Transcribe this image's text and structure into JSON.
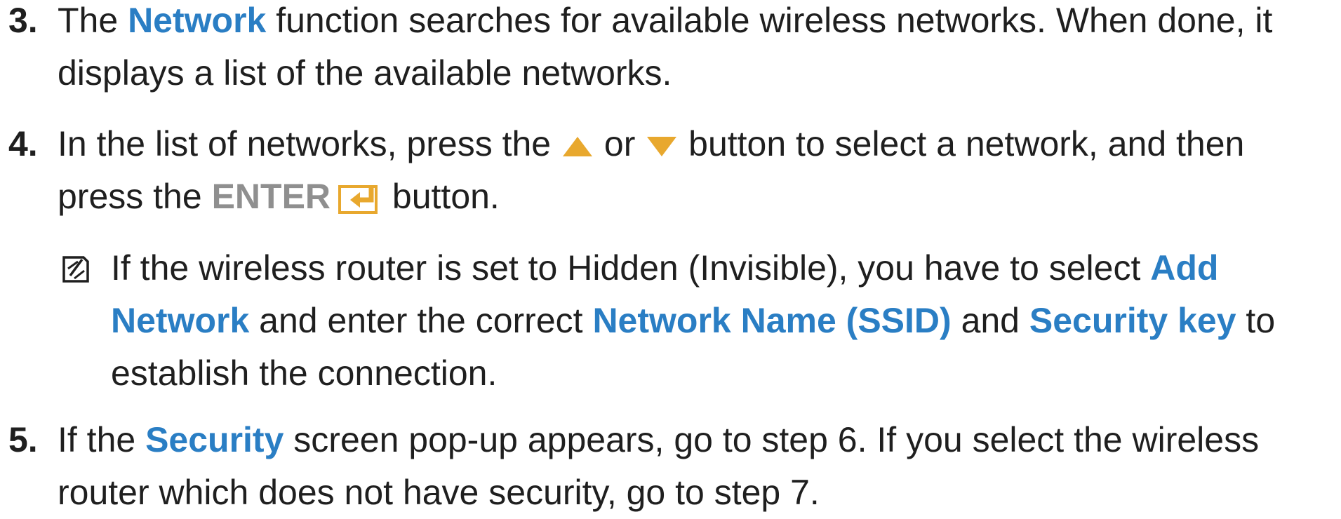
{
  "steps": [
    {
      "number": "3.",
      "line1": [
        "The ",
        "Network",
        " function searches for available wireless networks. When done, it"
      ],
      "line2": "displays a list of the available networks."
    },
    {
      "number": "4.",
      "line1": [
        "In the list of networks, press the ",
        " or ",
        " button to select a network, and then"
      ],
      "line2": [
        "press the ",
        "ENTER",
        " button."
      ],
      "icons": [
        "up-triangle-icon",
        "down-triangle-icon",
        "enter-icon"
      ]
    },
    {
      "number": "5.",
      "line1": [
        "If the ",
        "Security",
        " screen pop-up appears, go to step 6. If you select the wireless"
      ],
      "line2": "router which does not have security, go to step 7."
    }
  ],
  "note": {
    "icon": "note-icon",
    "line1": [
      "If the wireless router is set to Hidden (Invisible), you have to select ",
      "Add"
    ],
    "line2": [
      "Network",
      " and enter the correct ",
      "Network Name (SSID)",
      " and ",
      "Security key",
      " to"
    ],
    "line3": "establish the connection."
  },
  "colors": {
    "highlight": "#2a7ec4",
    "button_gold": "#e8a82e",
    "enter_gray": "#8f8f8f",
    "text": "#1f1f1f"
  }
}
